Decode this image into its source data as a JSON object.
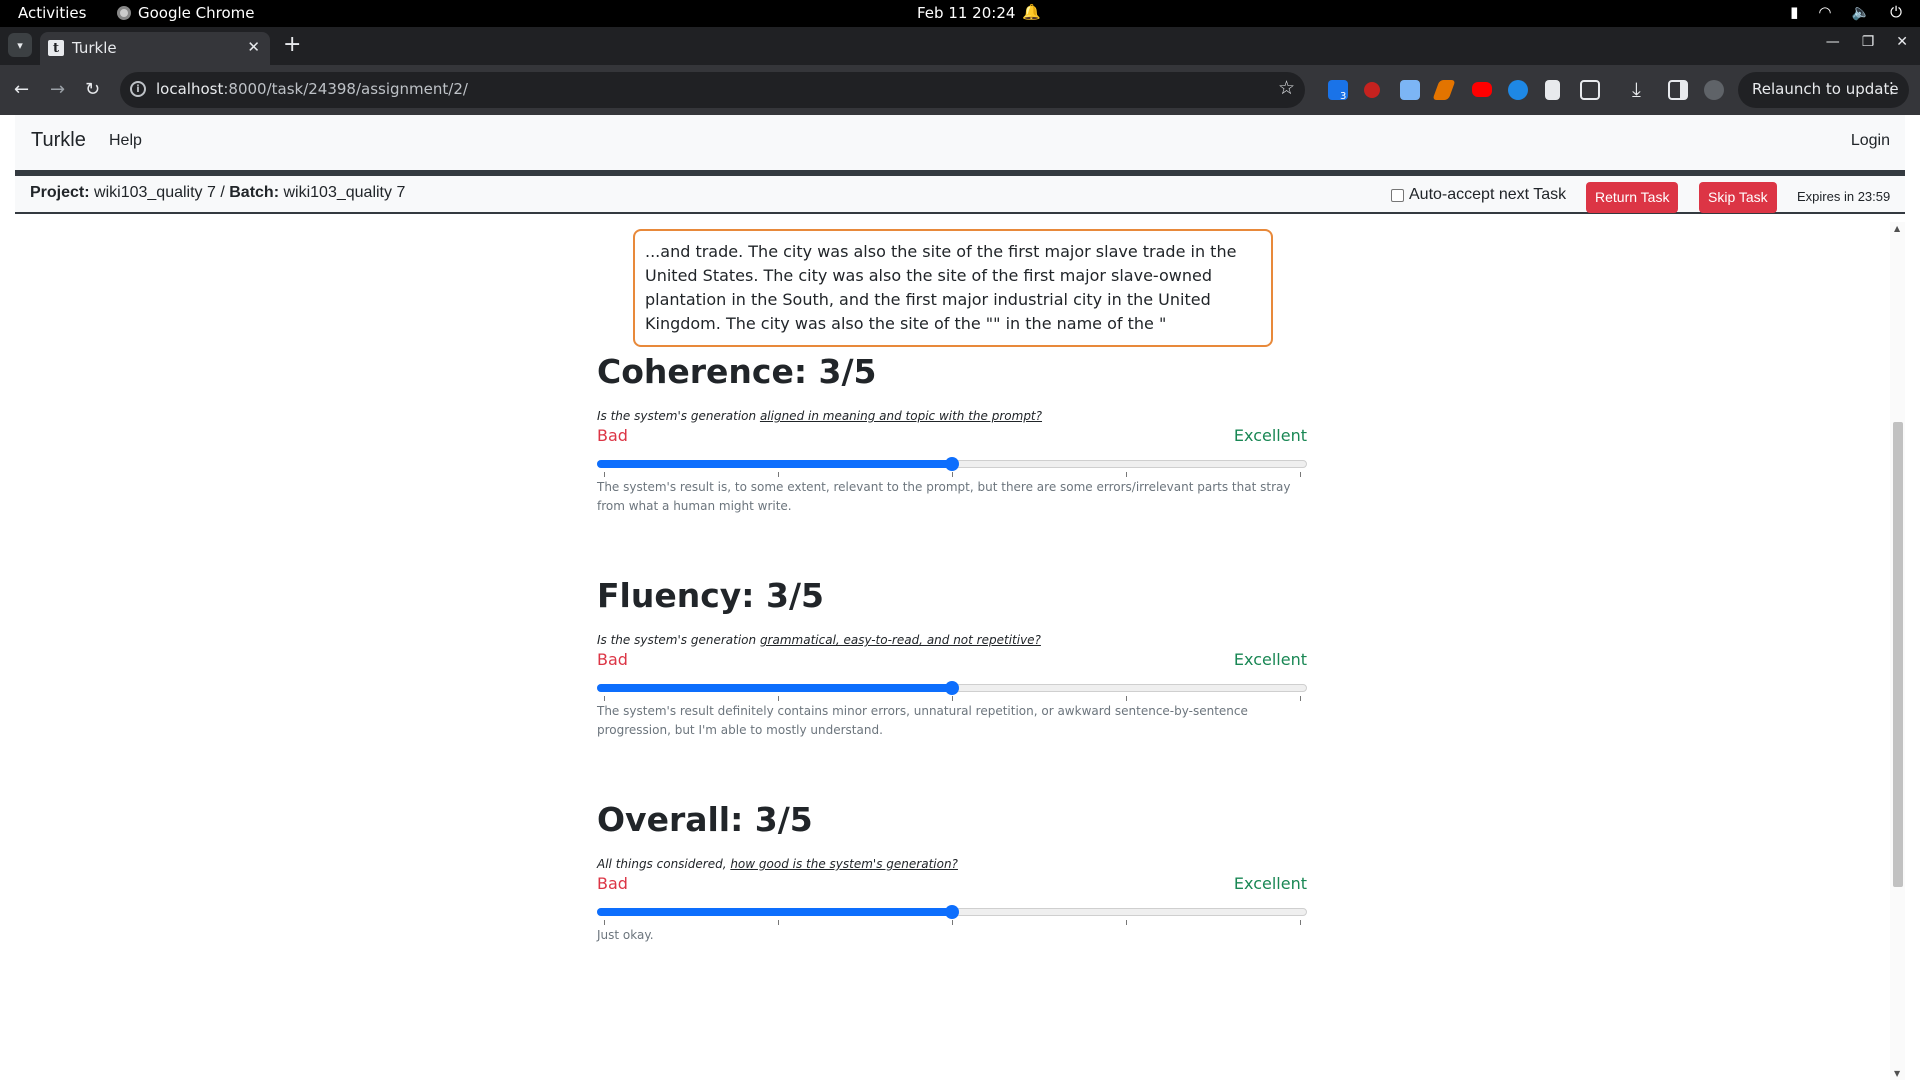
{
  "system_bar": {
    "activities": "Activities",
    "app_name": "Google Chrome",
    "clock": "Feb 11  20:24"
  },
  "browser": {
    "tab_title": "Turkle",
    "tab_favicon_letter": "t",
    "url_host": "localhost",
    "url_path": ":8000/task/24398/assignment/2/",
    "relaunch_label": "Relaunch to update",
    "extension_badge": "3"
  },
  "navbar": {
    "brand": "Turkle",
    "help": "Help",
    "login": "Login"
  },
  "taskbar": {
    "project_label": "Project:",
    "project_name": "wiki103_quality 7",
    "separator": "/",
    "batch_label": "Batch:",
    "batch_name": "wiki103_quality 7",
    "auto_accept_label": "Auto-accept next Task",
    "auto_accept_checked": false,
    "return_task": "Return Task",
    "skip_task": "Skip Task",
    "expires": "Expires in 23:59"
  },
  "generation_text": "...and trade. The city was also the site of the first major slave trade in the United States. The city was also the site of the first major slave-owned plantation in the South, and the first major industrial city in the United Kingdom. The city was also the site of the \"\" in the name of the \"",
  "questions": [
    {
      "title": "Coherence: 3/5",
      "prompt_prefix": "Is the system's generation ",
      "prompt_link": "aligned in meaning and topic with the prompt?",
      "low_label": "Bad",
      "high_label": "Excellent",
      "value": 3,
      "min": 1,
      "max": 5,
      "description": "The system's result is, to some extent, relevant to the prompt, but there are some errors/irrelevant parts that stray from what a human might write."
    },
    {
      "title": "Fluency: 3/5",
      "prompt_prefix": "Is the system's generation ",
      "prompt_link": "grammatical, easy-to-read, and not repetitive?",
      "low_label": "Bad",
      "high_label": "Excellent",
      "value": 3,
      "min": 1,
      "max": 5,
      "description": "The system's result definitely contains minor errors, unnatural repetition, or awkward sentence-by-sentence progression, but I'm able to mostly understand."
    },
    {
      "title": "Overall: 3/5",
      "prompt_prefix": "All things considered, ",
      "prompt_link": "how good is the system's generation?",
      "low_label": "Bad",
      "high_label": "Excellent",
      "value": 3,
      "min": 1,
      "max": 5,
      "description": "Just okay."
    }
  ],
  "colors": {
    "accent": "#0d6efd",
    "bad": "#dc3545",
    "excellent": "#198754",
    "generation_border": "#e8893a"
  }
}
